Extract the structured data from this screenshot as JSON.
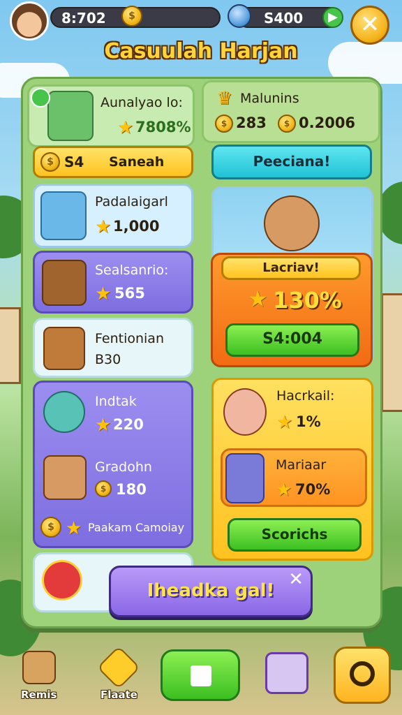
{
  "topbar": {
    "coins_value": "8:702",
    "gems_value": "S400",
    "coin_symbol": "$",
    "plus_symbol": "▶",
    "close_symbol": "✕"
  },
  "title": "Casuulah Harjan",
  "left": {
    "profile": {
      "name": "Aunalyao lo:",
      "score": "7808%",
      "badge_icon": "check-icon"
    },
    "search_button": {
      "value": "S4",
      "label": "Saneah"
    },
    "item1": {
      "name": "Padalaigarl",
      "value": "1,000"
    },
    "item2": {
      "name": "Sealsanrio:",
      "value": "565"
    },
    "item3": {
      "name": "Fentionian",
      "value": "B30"
    },
    "item4": {
      "name": "Indtak",
      "value": "220"
    },
    "item5": {
      "name": "Gradohn",
      "value": "180"
    },
    "footer_label": "Paakam Camoiay"
  },
  "right": {
    "header": {
      "name": "Malunins",
      "value_a": "283",
      "value_b": "0.2006"
    },
    "button_top": "Peeciana!",
    "offer": {
      "banner": "Lacriav!",
      "percent": "130%",
      "price": "S4:004"
    },
    "list": {
      "entry1": {
        "name": "Hacrkail:",
        "percent": "1%"
      },
      "entry2": {
        "name": "Mariaar",
        "percent": "70%"
      },
      "button": "Scorichs"
    }
  },
  "toast": {
    "text": "Iheadka gal!",
    "close": "✕"
  },
  "navbar": {
    "items": [
      {
        "label": "Remis",
        "icon": "house-icon"
      },
      {
        "label": "Flaate",
        "icon": "diamond-icon"
      },
      {
        "label": "",
        "icon": "play-icon"
      },
      {
        "label": "",
        "icon": "screen-icon"
      },
      {
        "label": "",
        "icon": "search-icon"
      }
    ]
  },
  "colors": {
    "gold": "#ffc20e",
    "green": "#3cbf22",
    "purple": "#7d6ee0",
    "orange": "#f26b12"
  }
}
